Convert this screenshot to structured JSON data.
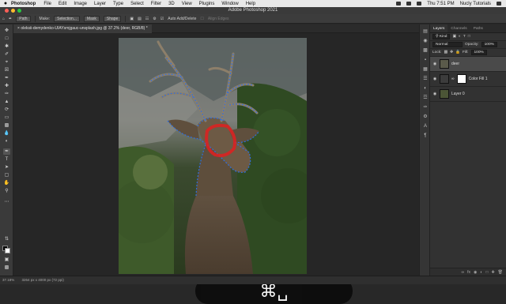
{
  "menubar": {
    "apple": "",
    "app": "Photoshop",
    "items": [
      "File",
      "Edit",
      "Image",
      "Layer",
      "Type",
      "Select",
      "Filter",
      "3D",
      "View",
      "Plugins",
      "Window",
      "Help"
    ],
    "clock": "Thu 7:51 PM",
    "user": "Nucly Tutorials"
  },
  "window": {
    "title": "Adobe Photoshop 2021"
  },
  "options": {
    "mode": "Path",
    "make_label": "Make:",
    "selection_button": "Selection...",
    "mask_button": "Mask",
    "shape_button": "Shape",
    "auto_add_delete": "Auto Add/Delete",
    "align_edges": "Align Edges"
  },
  "document": {
    "tab_title": "oleksii-demydenko-UIAYsmjgauc-unsplash.jpg @ 37.2% (deer, RGB/8) *"
  },
  "layers_panel": {
    "tabs": [
      "Layers",
      "Channels",
      "Paths"
    ],
    "filter_label": "Kind",
    "blend_mode": "Normal",
    "opacity_label": "Opacity:",
    "opacity_value": "100%",
    "lock_label": "Lock:",
    "fill_label": "Fill:",
    "fill_value": "100%",
    "layers": [
      {
        "name": "deer",
        "selected": true
      },
      {
        "name": "Color Fill 1",
        "selected": false
      },
      {
        "name": "Layer 0",
        "selected": false
      }
    ]
  },
  "status": {
    "zoom": "37.18%",
    "doc_info": "3264 px x 4000 px (72 ppi)"
  },
  "overlay": {
    "keys": "⌘␣"
  },
  "colors": {
    "accent": "#4a8ad6",
    "selection_red": "#e02020",
    "path_blue": "#2f6fe0"
  }
}
